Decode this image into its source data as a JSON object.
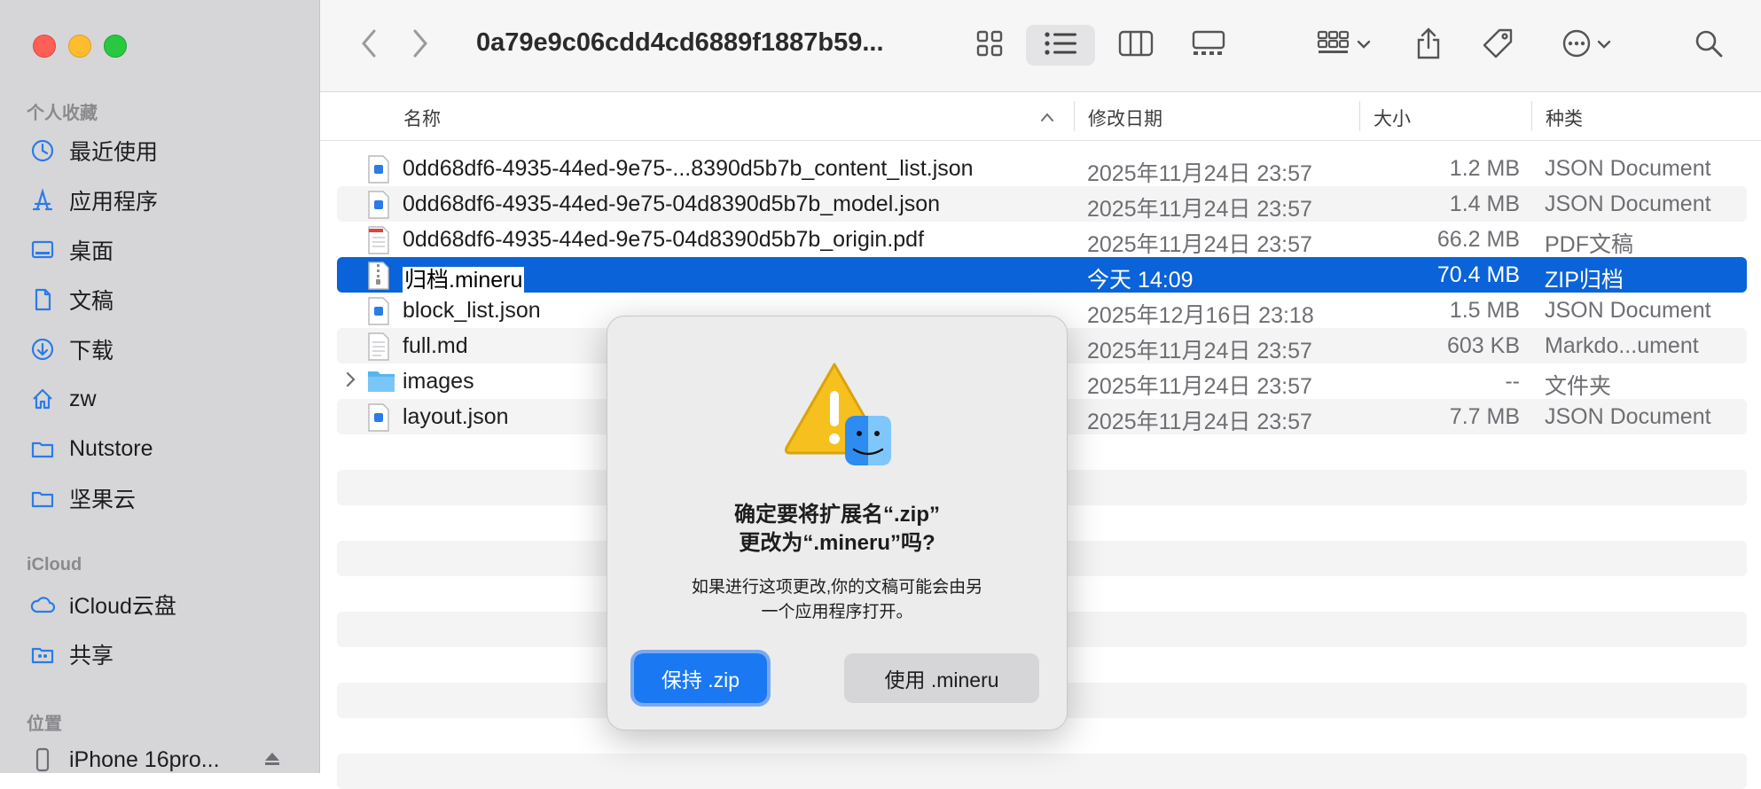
{
  "window": {
    "title": "0a79e9c06cdd4cd6889f1887b59..."
  },
  "sidebar": {
    "favorites_label": "个人收藏",
    "favorites": [
      {
        "label": "最近使用",
        "icon": "clock-icon"
      },
      {
        "label": "应用程序",
        "icon": "applications-icon"
      },
      {
        "label": "桌面",
        "icon": "desktop-icon"
      },
      {
        "label": "文稿",
        "icon": "document-icon"
      },
      {
        "label": "下载",
        "icon": "download-icon"
      },
      {
        "label": "zw",
        "icon": "home-icon"
      },
      {
        "label": "Nutstore",
        "icon": "folder-icon"
      },
      {
        "label": "坚果云",
        "icon": "folder-icon"
      }
    ],
    "icloud_label": "iCloud",
    "icloud": [
      {
        "label": "iCloud云盘",
        "icon": "cloud-icon"
      },
      {
        "label": "共享",
        "icon": "shared-folder-icon"
      }
    ],
    "locations_label": "位置",
    "locations": [
      {
        "label": "iPhone 16pro...",
        "icon": "iphone-icon"
      }
    ]
  },
  "columns": {
    "name": "名称",
    "date": "修改日期",
    "size": "大小",
    "kind": "种类"
  },
  "files": [
    {
      "name": "0dd68df6-4935-44ed-9e75-...8390d5b7b_content_list.json",
      "date": "2025年11月24日 23:57",
      "size": "1.2 MB",
      "kind": "JSON Document",
      "icon": "json-file-icon"
    },
    {
      "name": "0dd68df6-4935-44ed-9e75-04d8390d5b7b_model.json",
      "date": "2025年11月24日 23:57",
      "size": "1.4 MB",
      "kind": "JSON Document",
      "icon": "json-file-icon"
    },
    {
      "name": "0dd68df6-4935-44ed-9e75-04d8390d5b7b_origin.pdf",
      "date": "2025年11月24日 23:57",
      "size": "66.2 MB",
      "kind": "PDF文稿",
      "icon": "pdf-file-icon"
    },
    {
      "name": "归档.mineru",
      "date": "今天 14:09",
      "size": "70.4 MB",
      "kind": "ZIP归档",
      "icon": "zip-file-icon",
      "selected": true
    },
    {
      "name": "block_list.json",
      "date": "2025年12月16日 23:18",
      "size": "1.5 MB",
      "kind": "JSON Document",
      "icon": "json-file-icon"
    },
    {
      "name": "full.md",
      "date": "2025年11月24日 23:57",
      "size": "603 KB",
      "kind": "Markdo...ument",
      "icon": "markdown-file-icon"
    },
    {
      "name": "images",
      "date": "2025年11月24日 23:57",
      "size": "--",
      "kind": "文件夹",
      "icon": "folder-icon",
      "folder": true
    },
    {
      "name": "layout.json",
      "date": "2025年11月24日 23:57",
      "size": "7.7 MB",
      "kind": "JSON Document",
      "icon": "json-file-icon"
    }
  ],
  "dialog": {
    "title_line1": "确定要将扩展名“.zip”",
    "title_line2": "更改为“.mineru”吗?",
    "message_line1": "如果进行这项更改,你的文稿可能会由另",
    "message_line2": "一个应用程序打开。",
    "keep_button": "保持 .zip",
    "use_button": "使用 .mineru"
  },
  "colors": {
    "selection": "#0a63d8",
    "primary_button": "#1a78f2",
    "sidebar_bg": "#d6d6d8"
  }
}
